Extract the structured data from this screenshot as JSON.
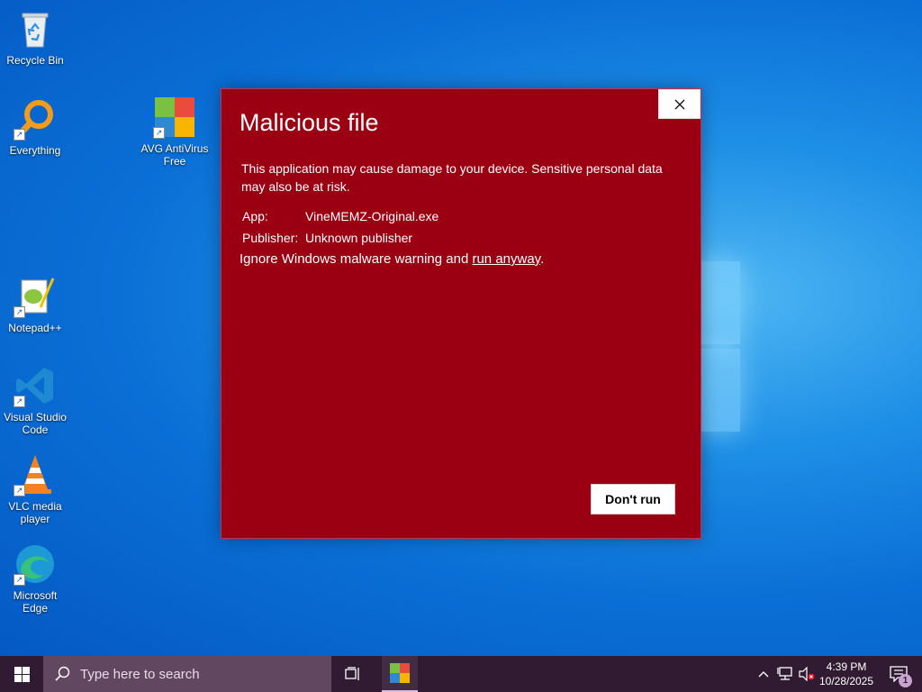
{
  "desktop": {
    "icons": [
      {
        "label": "Recycle Bin",
        "icon": "recycle-bin-icon"
      },
      {
        "label": "Everything",
        "icon": "everything-search-icon"
      },
      {
        "label": "AVG AntiVirus Free",
        "icon": "avg-antivirus-icon"
      },
      {
        "label": "Notepad++",
        "icon": "notepad-plus-plus-icon"
      },
      {
        "label": "Visual Studio Code",
        "icon": "vscode-icon"
      },
      {
        "label": "VLC media player",
        "icon": "vlc-icon"
      },
      {
        "label": "Microsoft Edge",
        "icon": "edge-icon"
      }
    ]
  },
  "dialog": {
    "title": "Malicious file",
    "description": "This application may cause damage to your device. Sensitive personal data may also be at risk.",
    "app_label": "App:",
    "app_value": "VineMEMZ-Original.exe",
    "publisher_label": "Publisher:",
    "publisher_value": "Unknown publisher",
    "warning_prefix": "Ignore Windows malware warning and ",
    "run_anyway_link": "run anyway",
    "warning_suffix": ".",
    "dont_run_label": "Don't run",
    "close_icon": "close-icon",
    "background_color": "#9b0012"
  },
  "taskbar": {
    "search_placeholder": "Type here to search",
    "time": "4:39 PM",
    "date": "10/28/2025",
    "notification_count": "1",
    "background_color": "#311b33"
  }
}
